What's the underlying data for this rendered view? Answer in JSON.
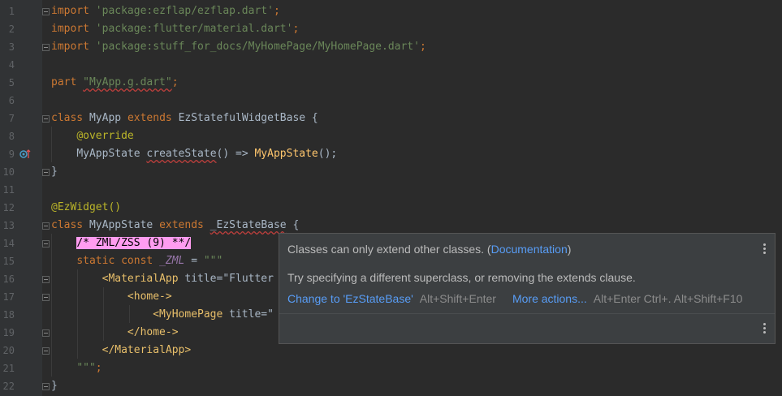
{
  "editor": {
    "lines": [
      {
        "n": "1"
      },
      {
        "n": "2"
      },
      {
        "n": "3"
      },
      {
        "n": "4"
      },
      {
        "n": "5"
      },
      {
        "n": "6"
      },
      {
        "n": "7"
      },
      {
        "n": "8"
      },
      {
        "n": "9"
      },
      {
        "n": "10"
      },
      {
        "n": "11"
      },
      {
        "n": "12"
      },
      {
        "n": "13"
      },
      {
        "n": "14"
      },
      {
        "n": "15"
      },
      {
        "n": "16"
      },
      {
        "n": "17"
      },
      {
        "n": "18"
      },
      {
        "n": "19"
      },
      {
        "n": "20"
      },
      {
        "n": "21"
      },
      {
        "n": "22"
      }
    ],
    "code": {
      "l1_kw": "import",
      "l1_str": "'package:ezflap/ezflap.dart'",
      "l1_semi": ";",
      "l2_kw": "import",
      "l2_str": "'package:flutter/material.dart'",
      "l2_semi": ";",
      "l3_kw": "import",
      "l3_str": "'package:stuff_for_docs/MyHomePage/MyHomePage.dart'",
      "l3_semi": ";",
      "l5_kw": "part",
      "l5_str": "\"MyApp.g.dart\"",
      "l5_semi": ";",
      "l7_kw1": "class",
      "l7_name": "MyApp",
      "l7_kw2": "extends",
      "l7_base": "EzStatefulWidgetBase {",
      "l8_ann": "@override",
      "l9_type": "MyAppState",
      "l9_fn": "createState",
      "l9_arrow": "() =>",
      "l9_call": "MyAppState",
      "l9_end": "();",
      "l10": "}",
      "l12_ann": "@EzWidget",
      "l12_paren": "()",
      "l13_kw1": "class",
      "l13_name": "MyAppState",
      "l13_kw2": "extends",
      "l13_base": "_EzStateBase",
      "l13_brace": " {",
      "l14_comment": "/* ZML/ZSS (9) **/",
      "l15_kw": "static const",
      "l15_var": "_ZML",
      "l15_eq": " = ",
      "l15_str": "\"\"\"",
      "l16_tag": "<MaterialApp",
      "l16_attr": " title=\"Flutter",
      "l17_tag": "<home->",
      "l18_tag": "<MyHomePage",
      "l18_attr": " title=\"",
      "l19_tag": "</home->",
      "l20_tag": "</MaterialApp>",
      "l21_str": "\"\"\"",
      "l21_semi": ";",
      "l22": "}"
    }
  },
  "popup": {
    "message": "Classes can only extend other classes. (",
    "doc_link": "Documentation",
    "message_end": ")",
    "hint": "Try specifying a different superclass, or removing the extends clause.",
    "action1_label": "Change to 'EzStateBase'",
    "action1_shortcut": "Alt+Shift+Enter",
    "action2_label": "More actions...",
    "action2_shortcut": "Alt+Enter Ctrl+. Alt+Shift+F10"
  },
  "colors": {
    "background": "#2b2b2b",
    "keyword": "#cc7832",
    "string": "#6a8759",
    "annotation": "#bbb529",
    "function": "#ffc66d",
    "link": "#589df6",
    "comment_highlight": "#ff9cf0"
  }
}
